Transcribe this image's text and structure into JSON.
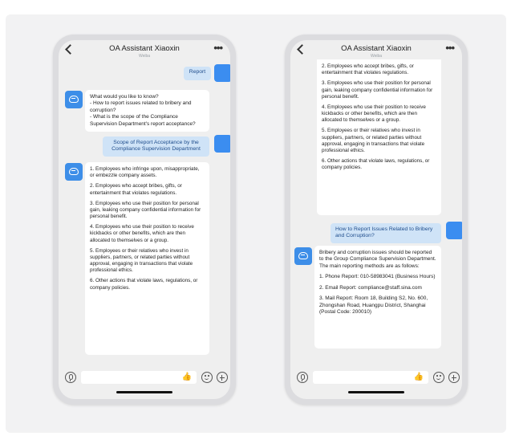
{
  "left_phone": {
    "header": {
      "title": "OA Assistant Xiaoxin",
      "subtitle": "Weiba"
    },
    "messages": {
      "user_1": "Report",
      "bot_1": [
        "What would you like to know?",
        "- How to report issues related to bribery and corruption?",
        "- What is the scope of the Compliance Supervision Department's report acceptance?"
      ],
      "user_2": "Scope of Report Acceptance by the Compliance Supervision Department",
      "bot_2": [
        "1. Employees who infringe upon, misappropriate, or embezzle company assets.",
        "2. Employees who accept bribes, gifts, or entertainment that violates regulations.",
        "3. Employees who use their position for personal gain, leaking company confidential information for personal benefit.",
        "4. Employees who use their position to receive kickbacks or other benefits, which are then allocated to themselves or a group.",
        "5. Employees or their relatives who invest in suppliers, partners, or related parties without approval, engaging in transactions that violate professional ethics.",
        "6. Other actions that violate laws, regulations, or company policies."
      ]
    }
  },
  "right_phone": {
    "header": {
      "title": "OA Assistant Xiaoxin",
      "subtitle": "Weiba"
    },
    "messages": {
      "bot_cont": [
        "2. Employees who accept bribes, gifts, or entertainment that violates regulations.",
        "3. Employees who use their position for personal gain, leaking company confidential information for personal benefit.",
        "4. Employees who use their position to receive kickbacks or other benefits, which are then allocated to themselves or a group.",
        "5. Employees or their relatives who invest in suppliers, partners, or related parties without approval, engaging in transactions that violate professional ethics.",
        "6. Other actions that violate laws, regulations, or company policies."
      ],
      "user_1": "How to Report Issues Related to Bribery and Corruption?",
      "bot_1": [
        "Bribery and corruption issues should be reported to the Group Compliance Supervision Department. The main reporting methods are as follows:",
        "1. Phone Report: 010-58983041 (Business Hours)",
        "2. Email Report: compliance@staff.sina.com",
        "3. Mail Report: Room 18, Building S2, No. 600, Zhongshan Road, Huangpu District, Shanghai (Postal Code: 200010)"
      ]
    }
  },
  "icons": {
    "thumb": "👍",
    "more": "•••"
  }
}
